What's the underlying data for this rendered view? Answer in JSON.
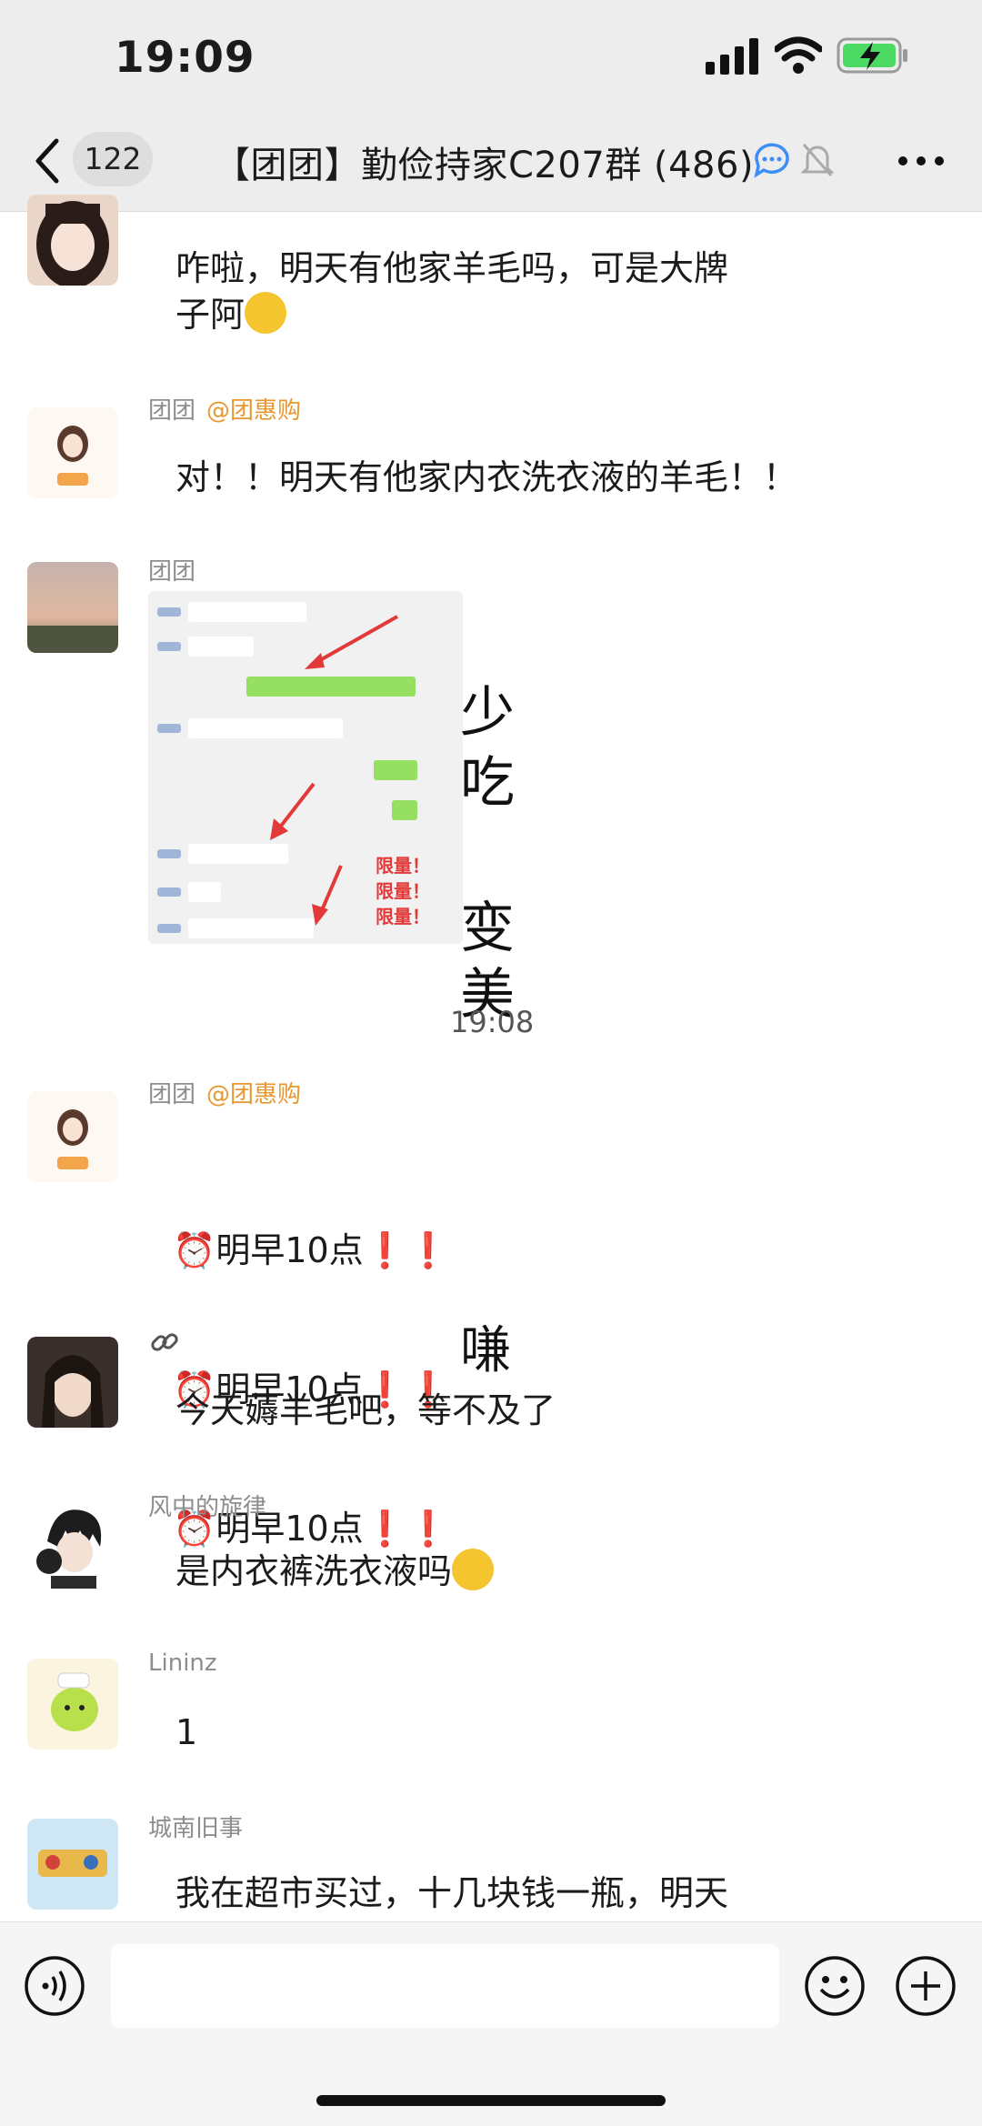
{
  "status_bar": {
    "time": "19:09",
    "battery": "charging"
  },
  "nav": {
    "unread_count": "122",
    "title": "【团团】勤俭持家C207群 (486)",
    "icons": [
      "back-icon",
      "chat-bubble-icon",
      "bell-muted-icon",
      "more-icon"
    ]
  },
  "messages": [
    {
      "sender": "",
      "text_lines": [
        "咋啦，明天有他家羊毛吗，可是大牌",
        "子阿"
      ],
      "emoji": "drooling-heart-eyes"
    },
    {
      "sender": "团团",
      "mention": "@团惠购",
      "text": "对！！明天有他家内衣洗衣液的羊毛！！"
    },
    {
      "sender": "团团",
      "image": {
        "side_text": [
          "少",
          "吃",
          "变",
          "美"
        ],
        "labels": [
          "限量！",
          "限量！",
          "限量！"
        ],
        "time": "19:08"
      }
    },
    {
      "sender": "团团",
      "mention": "@团惠购",
      "lines": [
        "明早10点",
        "明早10点",
        "明早10点"
      ],
      "peek_char": "嗛"
    },
    {
      "sender": "",
      "sender_icon": "link-icon",
      "text": "今天薅羊毛吧，等不及了"
    },
    {
      "sender": "风中的旋律",
      "text": "是内衣裤洗衣液吗",
      "emoji": "confused-face"
    },
    {
      "sender": "Lininz",
      "text": "1"
    },
    {
      "sender": "城南旧事",
      "text": "我在超市买过，十几块钱一瓶，明天"
    }
  ],
  "input_bar": {
    "placeholder": "",
    "icons": [
      "voice-icon",
      "emoji-icon",
      "plus-icon"
    ]
  },
  "colors": {
    "accent_mention": "#e6982f",
    "bg_bar": "#ededed",
    "bubble_green": "#95e063"
  }
}
